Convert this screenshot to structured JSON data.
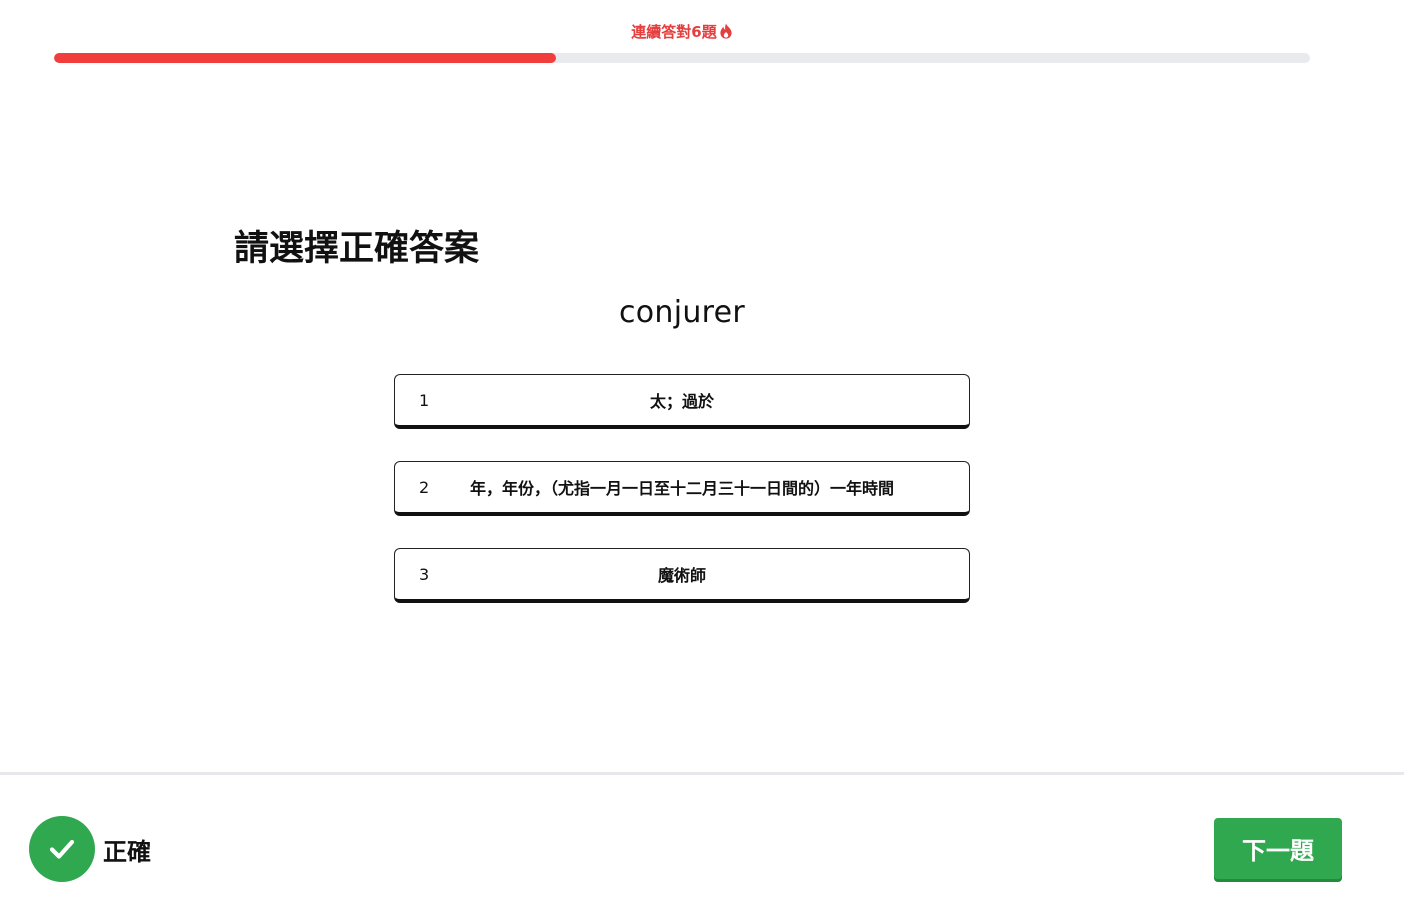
{
  "header": {
    "streak_label": "連續答對6題",
    "streak_icon": "fire-icon",
    "progress_fraction": 0.4
  },
  "question": {
    "prompt": "請選擇正確答案",
    "word": "conjurer"
  },
  "options": [
    {
      "number": "1",
      "text": "太；過於"
    },
    {
      "number": "2",
      "text": "年，年份，（尤指一月一日至十二月三十一日間的）一年時間"
    },
    {
      "number": "3",
      "text": "魔術師"
    }
  ],
  "footer": {
    "result_label": "正確",
    "result_icon": "checkmark-icon",
    "next_button_label": "下一題"
  },
  "colors": {
    "accent_red": "#f23d3d",
    "success_green": "#2fa84f",
    "track_gray": "#e8eaee"
  }
}
